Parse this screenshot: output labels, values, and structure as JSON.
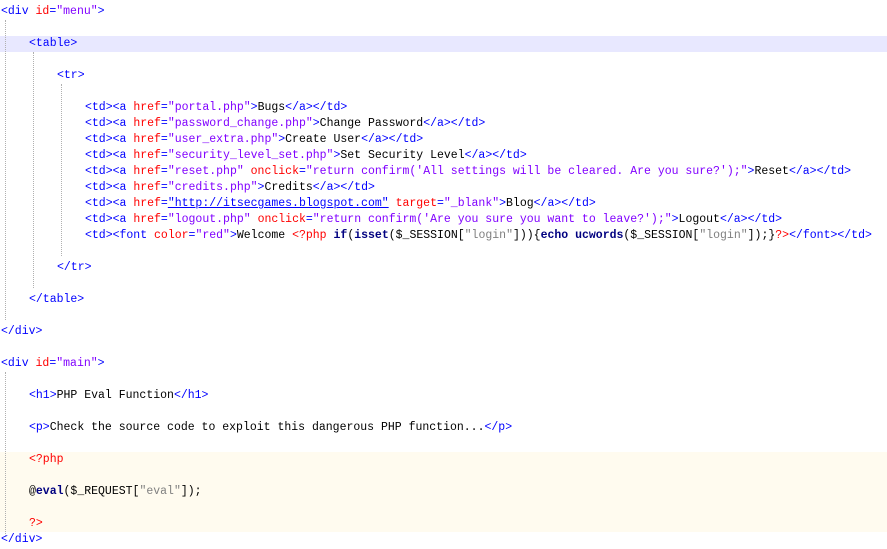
{
  "editor": {
    "lines": [
      {
        "indent": 0,
        "parts": [
          [
            "tag",
            "<div "
          ],
          [
            "attr",
            "id"
          ],
          [
            "tag",
            "="
          ],
          [
            "val",
            "\"menu\""
          ],
          [
            "tag",
            ">"
          ]
        ]
      },
      {
        "indent": 1,
        "parts": [
          [
            "tag",
            "<table>"
          ]
        ]
      },
      {
        "indent": 2,
        "parts": [
          [
            "tag",
            "<tr>"
          ]
        ]
      },
      {
        "indent": 3,
        "parts": [
          [
            "tag",
            "<td><a "
          ],
          [
            "attr",
            "href"
          ],
          [
            "tag",
            "="
          ],
          [
            "val",
            "\"portal.php\""
          ],
          [
            "tag",
            ">"
          ],
          [
            "txt",
            "Bugs"
          ],
          [
            "tag",
            "</a></td>"
          ]
        ]
      },
      {
        "indent": 3,
        "parts": [
          [
            "tag",
            "<td><a "
          ],
          [
            "attr",
            "href"
          ],
          [
            "tag",
            "="
          ],
          [
            "val",
            "\"password_change.php\""
          ],
          [
            "tag",
            ">"
          ],
          [
            "txt",
            "Change Password"
          ],
          [
            "tag",
            "</a></td>"
          ]
        ]
      },
      {
        "indent": 3,
        "parts": [
          [
            "tag",
            "<td><a "
          ],
          [
            "attr",
            "href"
          ],
          [
            "tag",
            "="
          ],
          [
            "val",
            "\"user_extra.php\""
          ],
          [
            "tag",
            ">"
          ],
          [
            "txt",
            "Create User"
          ],
          [
            "tag",
            "</a></td>"
          ]
        ]
      },
      {
        "indent": 3,
        "parts": [
          [
            "tag",
            "<td><a "
          ],
          [
            "attr",
            "href"
          ],
          [
            "tag",
            "="
          ],
          [
            "val",
            "\"security_level_set.php\""
          ],
          [
            "tag",
            ">"
          ],
          [
            "txt",
            "Set Security Level"
          ],
          [
            "tag",
            "</a></td>"
          ]
        ]
      },
      {
        "indent": 3,
        "parts": [
          [
            "tag",
            "<td><a "
          ],
          [
            "attr",
            "href"
          ],
          [
            "tag",
            "="
          ],
          [
            "val",
            "\"reset.php\""
          ],
          [
            "tag",
            " "
          ],
          [
            "attr",
            "onclick"
          ],
          [
            "tag",
            "="
          ],
          [
            "val",
            "\"return confirm('All settings will be cleared. Are you sure?');\""
          ],
          [
            "tag",
            ">"
          ],
          [
            "txt",
            "Reset"
          ],
          [
            "tag",
            "</a></td>"
          ]
        ]
      },
      {
        "indent": 3,
        "parts": [
          [
            "tag",
            "<td><a "
          ],
          [
            "attr",
            "href"
          ],
          [
            "tag",
            "="
          ],
          [
            "val",
            "\"credits.php\""
          ],
          [
            "tag",
            ">"
          ],
          [
            "txt",
            "Credits"
          ],
          [
            "tag",
            "</a></td>"
          ]
        ]
      },
      {
        "indent": 3,
        "parts": [
          [
            "tag",
            "<td><a "
          ],
          [
            "attr",
            "href"
          ],
          [
            "tag",
            "="
          ],
          [
            "url",
            "\"http://itsecgames.blogspot.com\""
          ],
          [
            "tag",
            " "
          ],
          [
            "attr",
            "target"
          ],
          [
            "tag",
            "="
          ],
          [
            "val",
            "\"_blank\""
          ],
          [
            "tag",
            ">"
          ],
          [
            "txt",
            "Blog"
          ],
          [
            "tag",
            "</a></td>"
          ]
        ]
      },
      {
        "indent": 3,
        "parts": [
          [
            "tag",
            "<td><a "
          ],
          [
            "attr",
            "href"
          ],
          [
            "tag",
            "="
          ],
          [
            "val",
            "\"logout.php\""
          ],
          [
            "tag",
            " "
          ],
          [
            "attr",
            "onclick"
          ],
          [
            "tag",
            "="
          ],
          [
            "val",
            "\"return confirm('Are you sure you want to leave?');\""
          ],
          [
            "tag",
            ">"
          ],
          [
            "txt",
            "Logout"
          ],
          [
            "tag",
            "</a></td>"
          ]
        ]
      },
      {
        "indent": 3,
        "parts": [
          [
            "tag",
            "<td><font "
          ],
          [
            "attr",
            "color"
          ],
          [
            "tag",
            "="
          ],
          [
            "val",
            "\"red\""
          ],
          [
            "tag",
            ">"
          ],
          [
            "txt",
            "Welcome "
          ],
          [
            "php",
            "<?php "
          ],
          [
            "kw",
            "if"
          ],
          [
            "ph",
            "("
          ],
          [
            "kw",
            "isset"
          ],
          [
            "ph",
            "($_SESSION["
          ],
          [
            "str",
            "\"login\""
          ],
          [
            "ph",
            "])){"
          ],
          [
            "kw",
            "echo"
          ],
          [
            "ph",
            " "
          ],
          [
            "kw",
            "ucwords"
          ],
          [
            "ph",
            "($_SESSION["
          ],
          [
            "str",
            "\"login\""
          ],
          [
            "ph",
            "]);}"
          ],
          [
            "php",
            "?>"
          ],
          [
            "tag",
            "</font></td>"
          ]
        ]
      },
      {
        "indent": 2,
        "parts": [
          [
            "tag",
            "</tr>"
          ]
        ]
      },
      {
        "indent": 1,
        "parts": [
          [
            "tag",
            "</table>"
          ]
        ]
      },
      {
        "indent": 0,
        "parts": [
          [
            "tag",
            "</div>"
          ]
        ]
      },
      {
        "indent": 0,
        "parts": [
          [
            "tag",
            "<div "
          ],
          [
            "attr",
            "id"
          ],
          [
            "tag",
            "="
          ],
          [
            "val",
            "\"main\""
          ],
          [
            "tag",
            ">"
          ]
        ]
      },
      {
        "indent": 1,
        "parts": [
          [
            "tag",
            "<h1>"
          ],
          [
            "txt",
            "PHP Eval Function"
          ],
          [
            "tag",
            "</h1>"
          ]
        ]
      },
      {
        "indent": 1,
        "parts": [
          [
            "tag",
            "<p>"
          ],
          [
            "txt",
            "Check the source code to exploit this dangerous PHP function..."
          ],
          [
            "tag",
            "</p>"
          ]
        ]
      },
      {
        "indent": 1,
        "parts": [
          [
            "php",
            "<?php"
          ]
        ]
      },
      {
        "indent": 1,
        "parts": [
          [
            "ph",
            "@"
          ],
          [
            "kw",
            "eval"
          ],
          [
            "ph",
            "($_REQUEST["
          ],
          [
            "str",
            "\"eval\""
          ],
          [
            "ph",
            "]);"
          ]
        ]
      },
      {
        "indent": 1,
        "parts": [
          [
            "php",
            "?>"
          ]
        ]
      },
      {
        "indent": 0,
        "parts": [
          [
            "tag",
            "</div>"
          ]
        ]
      }
    ]
  },
  "colors": {
    "tag": "#0000ff",
    "attribute": "#ff0000",
    "attribute_value": "#8000ff",
    "php_delimiter": "#ff0000",
    "php_keyword": "#000080",
    "php_string": "#808080",
    "current_line_highlight": "#e8e8ff",
    "php_block_background": "#fffbef"
  }
}
